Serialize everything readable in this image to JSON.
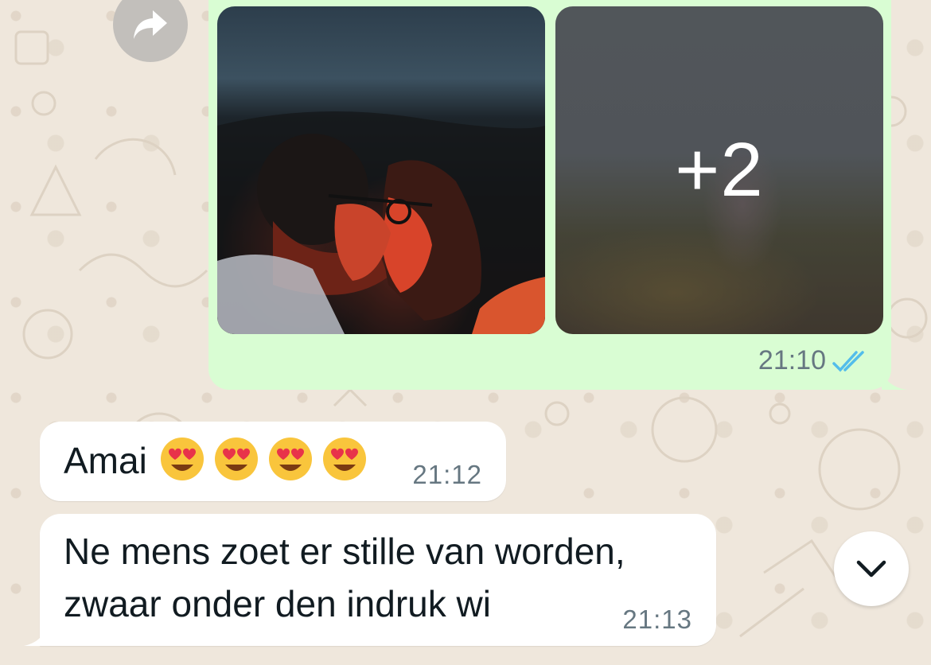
{
  "wallpaper": {
    "background_color": "#efe7dc"
  },
  "outgoing_media": {
    "photos": [
      {
        "icon": "photo-couple-kissing-red-light"
      },
      {
        "icon": "photo-blurred-more",
        "more_count": "+2"
      }
    ],
    "time": "21:10",
    "status_icon": "double-check-blue",
    "bubble_color": "#d9fdd3",
    "tick_color": "#53bdeb"
  },
  "incoming_messages": [
    {
      "text": "Amai",
      "emojis": [
        "heart-eyes",
        "heart-eyes",
        "heart-eyes",
        "heart-eyes"
      ],
      "time": "21:12"
    },
    {
      "text": "Ne mens zoet er stille van worden,\nzwaar onder den indruk wi",
      "time": "21:13"
    }
  ],
  "controls": {
    "forward_icon": "forward-arrow-icon",
    "scroll_down_icon": "chevron-down-icon"
  }
}
